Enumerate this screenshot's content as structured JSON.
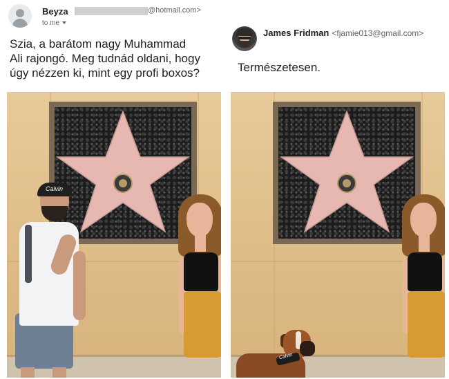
{
  "left_email": {
    "sender_name": "Beyza",
    "sender_domain": "@hotmail.com>",
    "recipient": "to me",
    "message_lines": [
      "Szia, a barátom nagy Muhammad",
      "Ali rajongó. Meg tudnád oldani, hogy",
      "úgy nézzen ki, mint egy profi boxos?"
    ],
    "photo": {
      "cap_text": "Calvin"
    }
  },
  "right_email": {
    "sender_name": "James Fridman",
    "sender_email": "<fjamie013@gmail.com>",
    "message": "Természetesen.",
    "photo": {
      "collar_text": "Calvin"
    }
  },
  "colors": {
    "wall": "#e0c08c",
    "plaque_star": "#e7b7b1",
    "text": "#202124"
  }
}
